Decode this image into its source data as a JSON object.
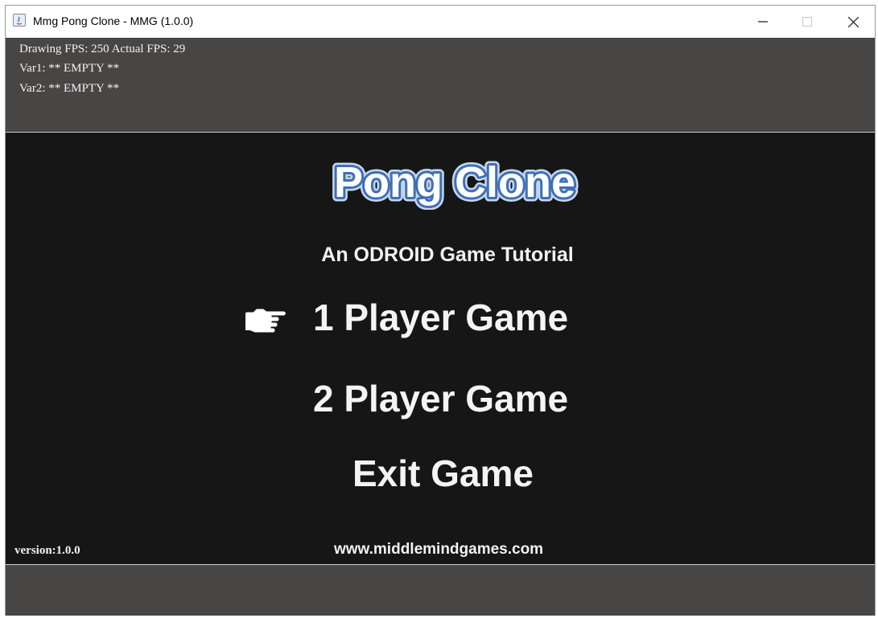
{
  "window": {
    "title": "Mmg Pong Clone - MMG (1.0.0)",
    "icon": "java-app-icon",
    "controls": [
      "minimize-icon",
      "maximize-icon",
      "close-icon"
    ]
  },
  "debug": {
    "line1": "Drawing FPS: 250 Actual FPS: 29",
    "line2": "Var1: ** EMPTY **",
    "line3": "Var2: ** EMPTY **"
  },
  "game": {
    "logo_text": "Pong Clone",
    "tagline": "An ODROID Game Tutorial",
    "menu": [
      {
        "label": "1 Player Game",
        "selected": true
      },
      {
        "label": "2 Player Game",
        "selected": false
      },
      {
        "label": "Exit Game",
        "selected": false
      }
    ],
    "selector_icon": "pointing-hand-icon",
    "version": "version:1.0.0",
    "website": "www.middlemindgames.com"
  },
  "colors": {
    "panel": "#484545",
    "game_bg": "#161616",
    "logo_fill": "#ffffff",
    "logo_outline": "#3f6fb5",
    "text": "#f2f2f2"
  }
}
